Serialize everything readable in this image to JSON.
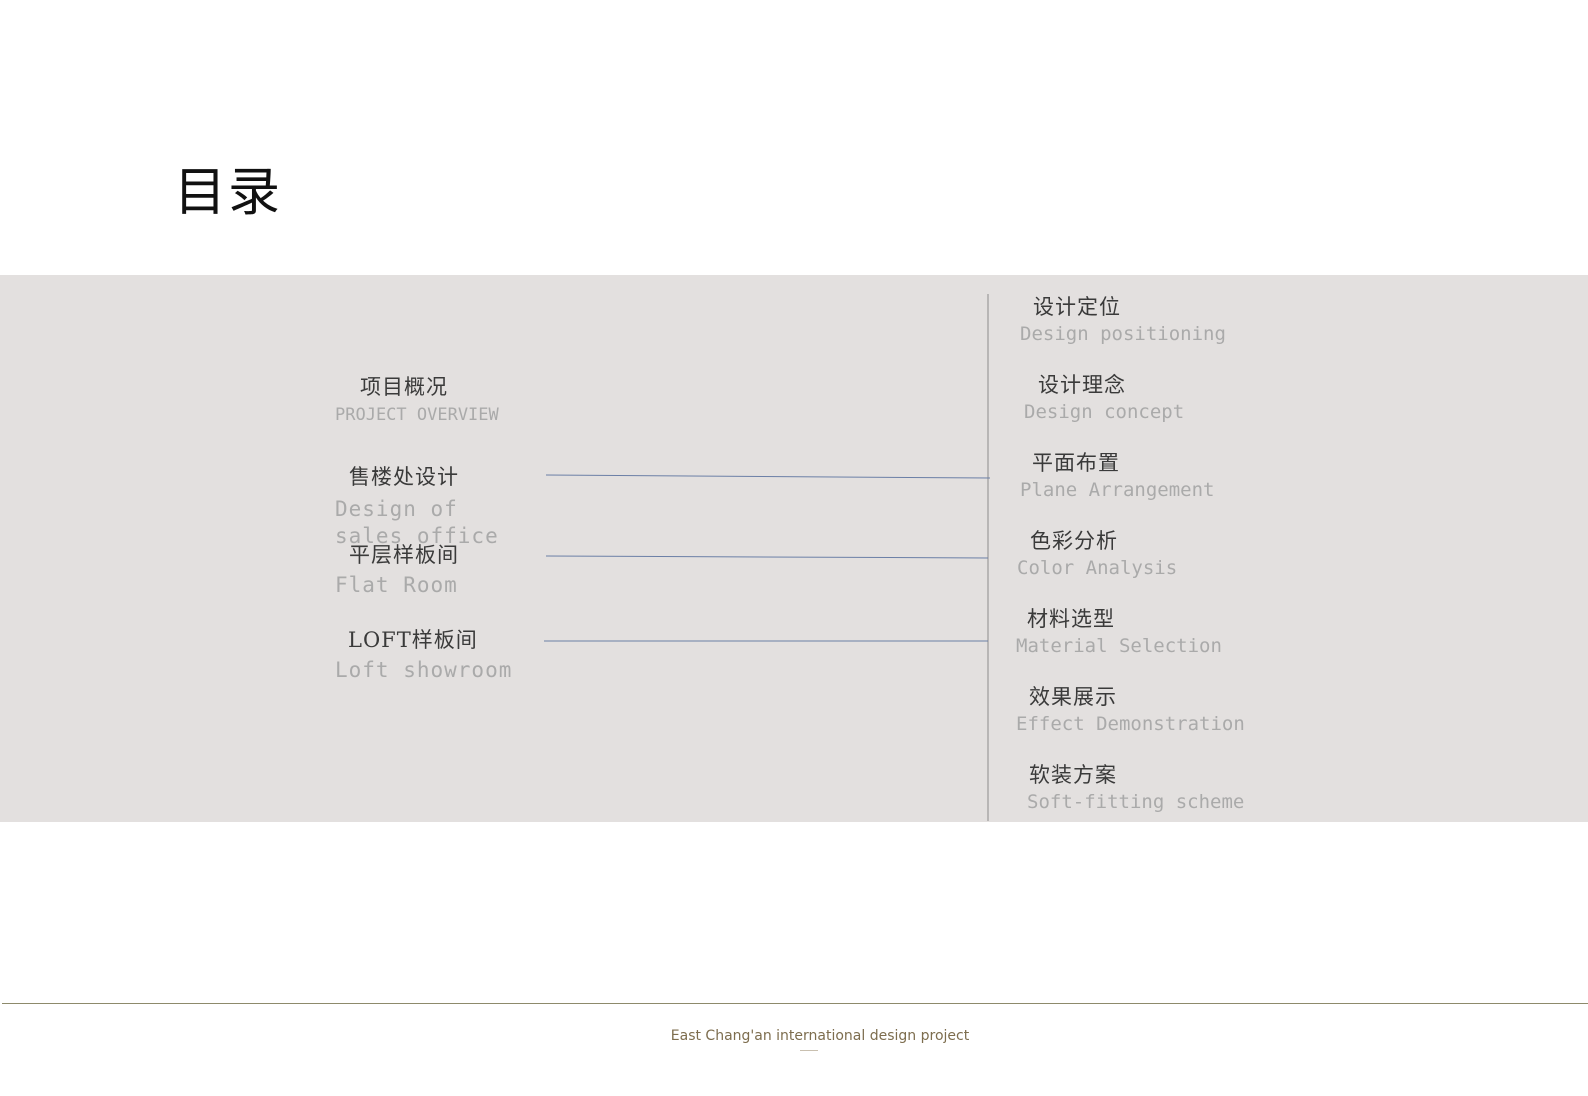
{
  "title": "目录",
  "left_sections": [
    {
      "cn": "项目概况",
      "en": "PROJECT OVERVIEW"
    },
    {
      "cn": "售楼处设计",
      "en": "Design of sales office"
    },
    {
      "cn": "平层样板间",
      "en": "Flat Room"
    },
    {
      "cn": "LOFT样板间",
      "en": "Loft showroom"
    }
  ],
  "right_sections": [
    {
      "cn": "设计定位",
      "en": "Design positioning"
    },
    {
      "cn": "设计理念",
      "en": "Design concept"
    },
    {
      "cn": "平面布置",
      "en": "Plane Arrangement"
    },
    {
      "cn": "色彩分析",
      "en": "Color Analysis"
    },
    {
      "cn": "材料选型",
      "en": "Material Selection"
    },
    {
      "cn": "效果展示",
      "en": "Effect Demonstration"
    },
    {
      "cn": "软装方案",
      "en": "Soft-fitting scheme"
    }
  ],
  "footer": {
    "text": "East Chang'an international design project"
  },
  "colors": {
    "band": "#e3e0df",
    "connector": "#6b7fa6",
    "footer_rule": "#8d8a6b"
  }
}
